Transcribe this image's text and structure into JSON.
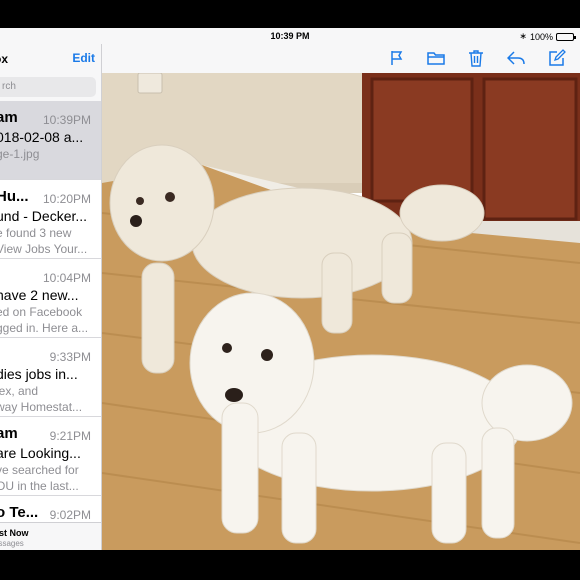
{
  "status": {
    "time": "10:39 PM",
    "battery": "100%"
  },
  "list": {
    "title": "ox",
    "edit_label": "Edit",
    "search_placeholder": "rch",
    "messages": [
      {
        "sender": "am",
        "time": "10:39PM",
        "subject": "018-02-08 a...",
        "preview": "ge-1.jpg",
        "preview2": ""
      },
      {
        "sender": "Hu...",
        "time": "10:20PM",
        "subject": "und - Decker...",
        "preview": "e found 3 new",
        "preview2": "View Jobs Your..."
      },
      {
        "sender": "",
        "time": "10:04PM",
        "subject": "have 2 new...",
        "preview": "ed on Facebook",
        "preview2": "gged in. Here a..."
      },
      {
        "sender": "",
        "time": "9:33PM",
        "subject": "dies jobs in...",
        "preview": "lex, and",
        "preview2": "way Homestat..."
      },
      {
        "sender": "am",
        "time": "9:21PM",
        "subject": "are Looking...",
        "preview": "ve searched for",
        "preview2": "OU in the last..."
      },
      {
        "sender": "o Te...",
        "time": "9:02PM",
        "subject": "",
        "preview": "",
        "preview2": ""
      }
    ],
    "footer_line1": "ast Now",
    "footer_line2": "essages"
  },
  "toolbar": {
    "icons": [
      "flag-icon",
      "folder-icon",
      "trash-icon",
      "reply-icon",
      "compose-icon"
    ],
    "accent": "#1a7ae8"
  }
}
